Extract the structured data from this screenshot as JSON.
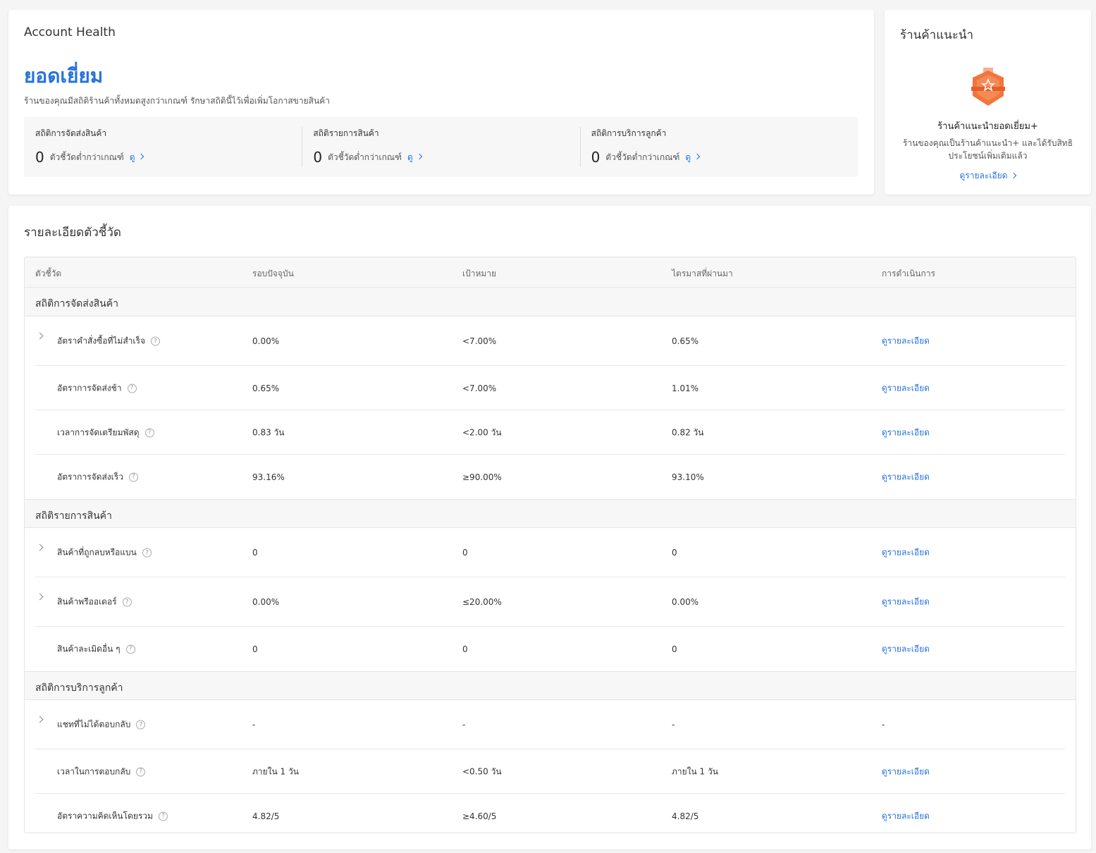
{
  "health": {
    "title": "Account Health",
    "status": "ยอดเยี่ยม",
    "description": "ร้านของคุณมีสถิติร้านค้าทั้งหมดสูงกว่าเกณฑ์ รักษาสถิตินี้ไว้เพื่อเพิ่มโอกาสขายสินค้า",
    "summary": [
      {
        "label": "สถิติการจัดส่งสินค้า",
        "count": "0",
        "text": "ตัวชี้วัดต่ำกว่าเกณฑ์",
        "link": "ดู"
      },
      {
        "label": "สถิติรายการสินค้า",
        "count": "0",
        "text": "ตัวชี้วัดต่ำกว่าเกณฑ์",
        "link": "ดู"
      },
      {
        "label": "สถิติการบริการลูกค้า",
        "count": "0",
        "text": "ตัวชี้วัดต่ำกว่าเกณฑ์",
        "link": "ดู"
      }
    ]
  },
  "recommended": {
    "title": "ร้านค้าแนะนำ",
    "badge_title": "ร้านค้าแนะนำยอดเยี่ยม+",
    "badge_desc": "ร้านของคุณเป็นร้านค้าแนะนำ+ และได้รับสิทธิประโยชน์เพิ่มเติมแล้ว",
    "link": "ดูรายละเอียด",
    "badge_color": "#f0763d"
  },
  "metrics": {
    "title": "รายละเอียดตัวชี้วัด",
    "columns": [
      "ตัวชี้วัด",
      "รอบปัจจุบัน",
      "เป้าหมาย",
      "ไตรมาสที่ผ่านมา",
      "การดำเนินการ"
    ],
    "groups": [
      {
        "name": "สถิติการจัดส่งสินค้า",
        "rows": [
          {
            "name": "อัตราคำสั่งซื้อที่ไม่สำเร็จ",
            "current": "0.00%",
            "target": "<7.00%",
            "previous": "0.65%",
            "action": "ดูรายละเอียด",
            "expandable": true
          },
          {
            "name": "อัตราการจัดส่งช้า",
            "current": "0.65%",
            "target": "<7.00%",
            "previous": "1.01%",
            "action": "ดูรายละเอียด",
            "expandable": false
          },
          {
            "name": "เวลาการจัดเตรียมพัสดุ",
            "current": "0.83 วัน",
            "target": "<2.00 วัน",
            "previous": "0.82 วัน",
            "action": "ดูรายละเอียด",
            "expandable": false
          },
          {
            "name": "อัตราการจัดส่งเร็ว",
            "current": "93.16%",
            "target": "≥90.00%",
            "previous": "93.10%",
            "action": "ดูรายละเอียด",
            "expandable": false
          }
        ]
      },
      {
        "name": "สถิติรายการสินค้า",
        "rows": [
          {
            "name": "สินค้าที่ถูกลบหรือแบน",
            "current": "0",
            "target": "0",
            "previous": "0",
            "action": "ดูรายละเอียด",
            "expandable": true
          },
          {
            "name": "สินค้าพรีออเดอร์",
            "current": "0.00%",
            "target": "≤20.00%",
            "previous": "0.00%",
            "action": "ดูรายละเอียด",
            "expandable": true
          },
          {
            "name": "สินค้าละเมิดอื่น ๆ",
            "current": "0",
            "target": "0",
            "previous": "0",
            "action": "ดูรายละเอียด",
            "expandable": false
          }
        ]
      },
      {
        "name": "สถิติการบริการลูกค้า",
        "rows": [
          {
            "name": "แชทที่ไม่ได้ตอบกลับ",
            "current": "-",
            "target": "-",
            "previous": "-",
            "action": "-",
            "expandable": true
          },
          {
            "name": "เวลาในการตอบกลับ",
            "current": "ภายใน 1 วัน",
            "target": "<0.50 วัน",
            "previous": "ภายใน 1 วัน",
            "action": "ดูรายละเอียด",
            "expandable": false
          },
          {
            "name": "อัตราความคิดเห็นโดยรวม",
            "current": "4.82/5",
            "target": "≥4.60/5",
            "previous": "4.82/5",
            "action": "ดูรายละเอียด",
            "expandable": false
          }
        ]
      }
    ]
  }
}
